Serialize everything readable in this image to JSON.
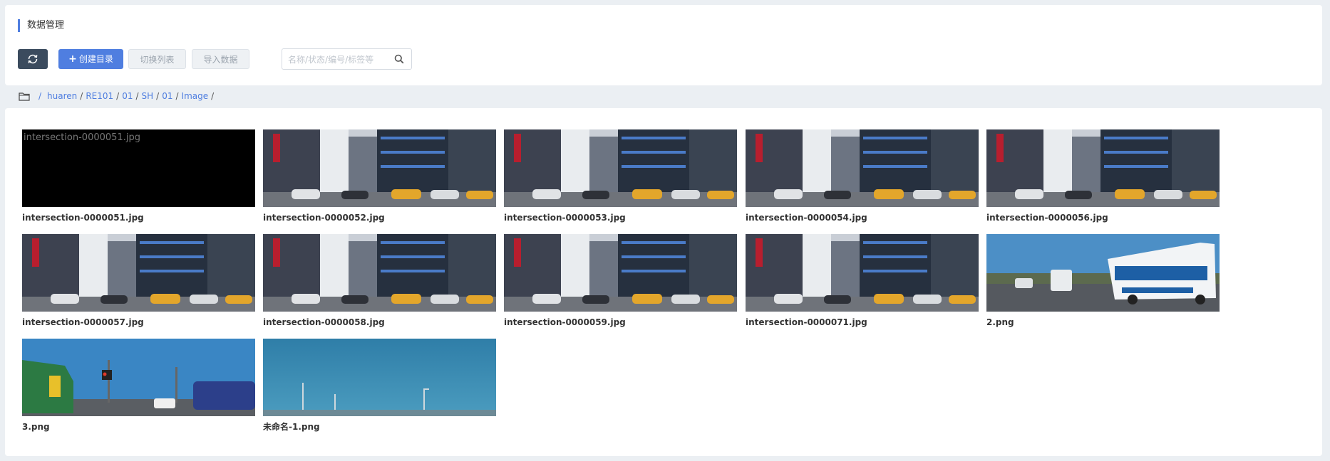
{
  "header": {
    "title": "数据管理"
  },
  "toolbar": {
    "refresh_icon": "refresh-icon",
    "create_label": "创建目录",
    "create_icon": "plus-icon",
    "switch_label": "切换列表",
    "import_label": "导入数据"
  },
  "search": {
    "placeholder": "名称/状态/编号/标签等",
    "value": "",
    "icon": "search-icon"
  },
  "breadcrumb": {
    "icon": "folder-icon",
    "items": [
      "huaren",
      "RE101",
      "01",
      "SH",
      "01",
      "Image"
    ]
  },
  "files": [
    {
      "name": "intersection-0000051.jpg",
      "thumb": "broken",
      "alt": "intersection-0000051.jpg"
    },
    {
      "name": "intersection-0000052.jpg",
      "thumb": "street"
    },
    {
      "name": "intersection-0000053.jpg",
      "thumb": "street"
    },
    {
      "name": "intersection-0000054.jpg",
      "thumb": "street"
    },
    {
      "name": "intersection-0000056.jpg",
      "thumb": "street"
    },
    {
      "name": "intersection-0000057.jpg",
      "thumb": "street"
    },
    {
      "name": "intersection-0000058.jpg",
      "thumb": "street"
    },
    {
      "name": "intersection-0000059.jpg",
      "thumb": "street"
    },
    {
      "name": "intersection-0000071.jpg",
      "thumb": "street"
    },
    {
      "name": "2.png",
      "thumb": "bus"
    },
    {
      "name": "3.png",
      "thumb": "post"
    },
    {
      "name": "未命名-1.png",
      "thumb": "sky"
    }
  ],
  "colors": {
    "accent": "#4f7ee0",
    "dark_button": "#3b4b5e",
    "page_bg": "#ebeff3"
  }
}
